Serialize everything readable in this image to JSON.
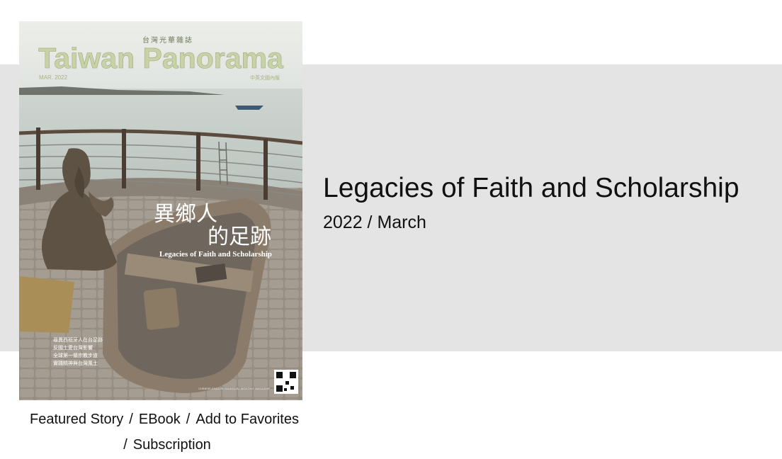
{
  "cover": {
    "masthead_cn": "台灣光華雜誌",
    "masthead": "Taiwan Panorama",
    "issue_tag": "MAR. 2022",
    "edition_tag": "中英文國內版",
    "headline_cn_line1": "異鄉人",
    "headline_cn_line2": "的足跡",
    "headline_en": "Legacies of Faith and Scholarship",
    "blurb_lines": [
      "尋異西班牙人在台足跡",
      "反國土愛台灣影響",
      "全球第一條宗教步道",
      "實踐精神與台灣風土"
    ],
    "footer_text": "CHINESE-ENGLISH BILINGUAL MONTHLY MAGAZINE",
    "colors": {
      "masthead": "#c8d2a6",
      "sky": "#e9ebe6",
      "sea": "#c9d1cc"
    }
  },
  "article": {
    "title": "Legacies of Faith and Scholarship",
    "date": "2022 / March"
  },
  "links": {
    "featured_story": "Featured Story",
    "ebook": "EBook",
    "add_to_favorites": "Add to Favorites",
    "subscription": "Subscription",
    "separator": "/"
  },
  "colors": {
    "band": "#e4e4e4",
    "text": "#111111"
  }
}
